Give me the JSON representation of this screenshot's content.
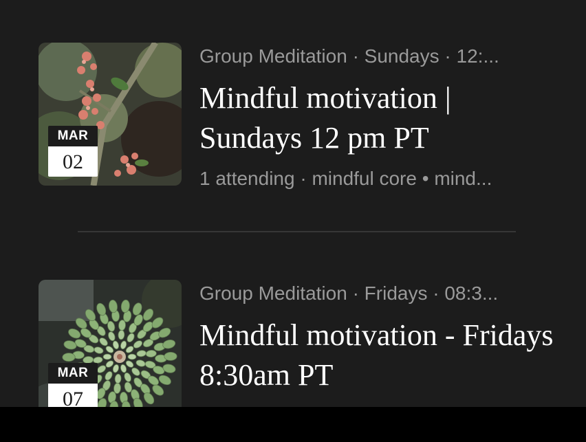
{
  "events": [
    {
      "month": "MAR",
      "day": "02",
      "meta": "Group Meditation · Sundays · 12:...",
      "title": "Mindful motivation | Sundays 12 pm PT",
      "subtitle": "1 attending · mindful core • mind..."
    },
    {
      "month": "MAR",
      "day": "07",
      "meta": "Group Meditation · Fridays · 08:3...",
      "title": "Mindful motivation - Fridays 8:30am PT",
      "subtitle": ""
    }
  ],
  "colors": {
    "background": "#1c1c1c",
    "text_primary": "#ffffff",
    "text_secondary": "#9a9a9a",
    "divider": "#363636"
  }
}
